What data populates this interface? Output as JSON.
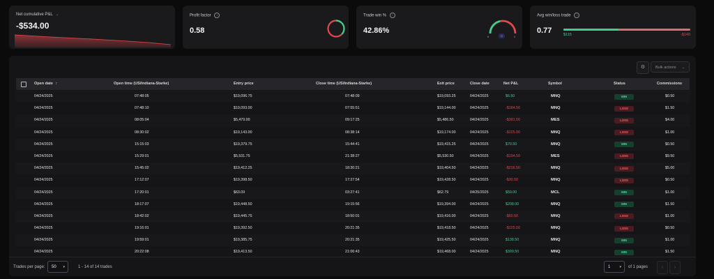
{
  "cards": {
    "net_pnl": {
      "label": "Net cumulative P&L",
      "value": "-$534.00",
      "icon": "chevron-icon"
    },
    "profit_factor": {
      "label": "Profit factor",
      "value": "0.58",
      "info_icon": "info-icon",
      "ratio": 0.58
    },
    "trade_win": {
      "label": "Trade win %",
      "value": "42.86%",
      "win_pct": 42.86,
      "count_win": "6",
      "count_even": "0",
      "count_loss": "8"
    },
    "avg_win_loss": {
      "label": "Avg win/loss trade",
      "value": "0.77",
      "avg_win": "$115",
      "avg_loss": "-$149"
    }
  },
  "colors": {
    "win": "#3ecf8e",
    "loss": "#e5484d",
    "neutral": "#3b3b8f"
  },
  "toolbar": {
    "bulk_actions": "Bulk actions",
    "settings_icon": "gear-icon"
  },
  "table": {
    "headers": {
      "open_date": "Open date",
      "open_time": "Open time (US/Indiana-Starke)",
      "entry_price": "Entry price",
      "close_time": "Close time (US/Indiana-Starke)",
      "exit_price": "Exit price",
      "close_date": "Close date",
      "net_pnl": "Net P&L",
      "symbol": "Symbol",
      "status": "Status",
      "commissions": "Commissions"
    },
    "sort_icon": "arrow-up-icon",
    "rows": [
      {
        "open_date": "04/24/2025",
        "open_time": "07:48:05",
        "entry": "$19,096.75",
        "close_time": "07:48:09",
        "exit": "$19,093.25",
        "close_date": "04/24/2025",
        "pnl": "$6.50",
        "pnl_type": "win",
        "symbol": "MNQ",
        "status": "WIN",
        "comm": "$0.50"
      },
      {
        "open_date": "04/24/2025",
        "open_time": "07:48:10",
        "entry": "$19,093.00",
        "close_time": "07:55:51",
        "exit": "$19,144.00",
        "close_date": "04/24/2025",
        "pnl": "-$184.50",
        "pnl_type": "loss",
        "symbol": "MNQ",
        "status": "LOSS",
        "comm": "$1.50"
      },
      {
        "open_date": "04/24/2025",
        "open_time": "08:05:04",
        "entry": "$5,479.00",
        "close_time": "09:17:25",
        "exit": "$5,486.50",
        "close_date": "04/24/2025",
        "pnl": "-$391.50",
        "pnl_type": "loss",
        "symbol": "MES",
        "status": "LOSS",
        "comm": "$4.00"
      },
      {
        "open_date": "04/24/2025",
        "open_time": "08:30:02",
        "entry": "$19,143.00",
        "close_time": "08:38:14",
        "exit": "$19,174.00",
        "close_date": "04/24/2025",
        "pnl": "-$125.00",
        "pnl_type": "loss",
        "symbol": "MNQ",
        "status": "LOSS",
        "comm": "$1.00"
      },
      {
        "open_date": "04/24/2025",
        "open_time": "15:15:03",
        "entry": "$19,379.75",
        "close_time": "15:44:41",
        "exit": "$19,415.25",
        "close_date": "04/24/2025",
        "pnl": "$70.50",
        "pnl_type": "win",
        "symbol": "MNQ",
        "status": "WIN",
        "comm": "$0.50"
      },
      {
        "open_date": "04/24/2025",
        "open_time": "15:29:01",
        "entry": "$5,531.75",
        "close_time": "21:38:27",
        "exit": "$5,530.50",
        "close_date": "04/24/2025",
        "pnl": "-$194.50",
        "pnl_type": "loss",
        "symbol": "MES",
        "status": "LOSS",
        "comm": "$9.50"
      },
      {
        "open_date": "04/24/2025",
        "open_time": "15:45:02",
        "entry": "$19,412.25",
        "close_time": "18:30:21",
        "exit": "$19,404.50",
        "close_date": "04/24/2025",
        "pnl": "-$216.50",
        "pnl_type": "loss",
        "symbol": "MNQ",
        "status": "LOSS",
        "comm": "$5.00"
      },
      {
        "open_date": "04/24/2025",
        "open_time": "17:12:07",
        "entry": "$19,398.50",
        "close_time": "17:27:54",
        "exit": "$19,428.50",
        "close_date": "04/24/2025",
        "pnl": "-$30.50",
        "pnl_type": "loss",
        "symbol": "MNQ",
        "status": "LOSS",
        "comm": "$0.50"
      },
      {
        "open_date": "04/24/2025",
        "open_time": "17:20:01",
        "entry": "$63.09",
        "close_time": "03:27:41",
        "exit": "$62.79",
        "close_date": "04/25/2025",
        "pnl": "$59.00",
        "pnl_type": "win",
        "symbol": "MCL",
        "status": "WIN",
        "comm": "$1.00"
      },
      {
        "open_date": "04/24/2025",
        "open_time": "18:17:07",
        "entry": "$19,448.50",
        "close_time": "19:15:56",
        "exit": "$19,394.00",
        "close_date": "04/24/2025",
        "pnl": "$208.00",
        "pnl_type": "win",
        "symbol": "MNQ",
        "status": "WIN",
        "comm": "$1.50"
      },
      {
        "open_date": "04/24/2025",
        "open_time": "18:42:02",
        "entry": "$19,445.75",
        "close_time": "18:50:01",
        "exit": "$19,416.00",
        "close_date": "04/24/2025",
        "pnl": "-$60.50",
        "pnl_type": "loss",
        "symbol": "MNQ",
        "status": "LOSS",
        "comm": "$1.00"
      },
      {
        "open_date": "04/24/2025",
        "open_time": "19:16:01",
        "entry": "$19,392.50",
        "close_time": "20:21:35",
        "exit": "$19,418.50",
        "close_date": "04/24/2025",
        "pnl": "-$125.50",
        "pnl_type": "loss",
        "symbol": "MNQ",
        "status": "LOSS",
        "comm": "$0.50"
      },
      {
        "open_date": "04/24/2025",
        "open_time": "19:59:01",
        "entry": "$19,385.75",
        "close_time": "20:21:35",
        "exit": "$19,425.50",
        "close_date": "04/24/2025",
        "pnl": "$138.50",
        "pnl_type": "win",
        "symbol": "MNQ",
        "status": "WIN",
        "comm": "$1.00"
      },
      {
        "open_date": "04/24/2025",
        "open_time": "20:22:08",
        "entry": "$19,413.50",
        "close_time": "21:06:43",
        "exit": "$19,468.00",
        "close_date": "04/24/2025",
        "pnl": "$309.50",
        "pnl_type": "win",
        "symbol": "MNQ",
        "status": "WIN",
        "comm": "$1.50"
      }
    ]
  },
  "footer": {
    "trades_per_page_label": "Trades per page:",
    "trades_per_page_value": "50",
    "range_text": "1 - 14 of 14 trades",
    "page_value": "1",
    "pages_text": "of 1 pages",
    "prev_icon": "chevron-left-icon",
    "next_icon": "chevron-right-icon"
  }
}
